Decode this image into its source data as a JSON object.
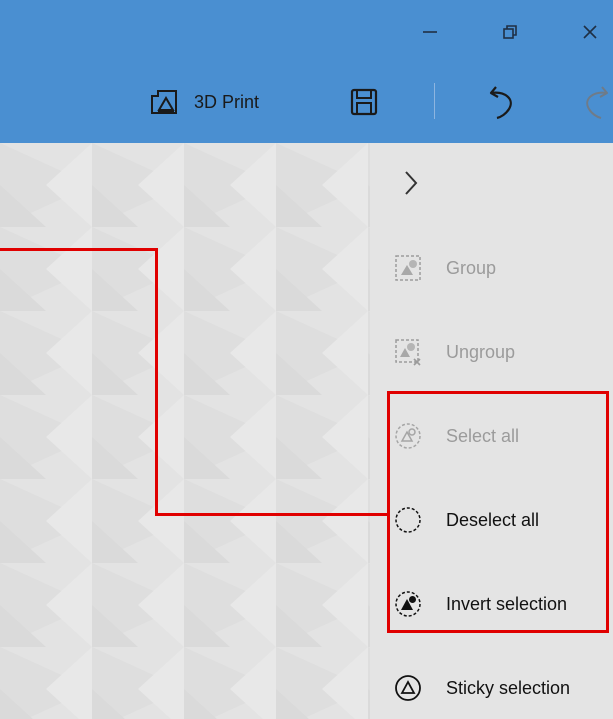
{
  "window": {
    "controls": {
      "minimize": "minimize",
      "maximize": "maximize",
      "close": "close"
    }
  },
  "toolbar": {
    "print_label": "3D Print",
    "icons": {
      "print": "3d-print-icon",
      "save": "save-icon",
      "undo": "undo-icon",
      "redo": "redo-icon"
    }
  },
  "panel": {
    "expand_icon": "chevron-right-icon",
    "items": [
      {
        "label": "Group",
        "icon": "group-icon",
        "enabled": false
      },
      {
        "label": "Ungroup",
        "icon": "ungroup-icon",
        "enabled": false
      },
      {
        "label": "Select all",
        "icon": "select-all-icon",
        "enabled": false
      },
      {
        "label": "Deselect all",
        "icon": "deselect-all-icon",
        "enabled": true
      },
      {
        "label": "Invert selection",
        "icon": "invert-selection-icon",
        "enabled": true
      },
      {
        "label": "Sticky selection",
        "icon": "sticky-selection-icon",
        "enabled": true
      }
    ]
  },
  "colors": {
    "titlebar": "#4a8fd1",
    "highlight": "#e00000",
    "panel": "#e4e4e4"
  }
}
